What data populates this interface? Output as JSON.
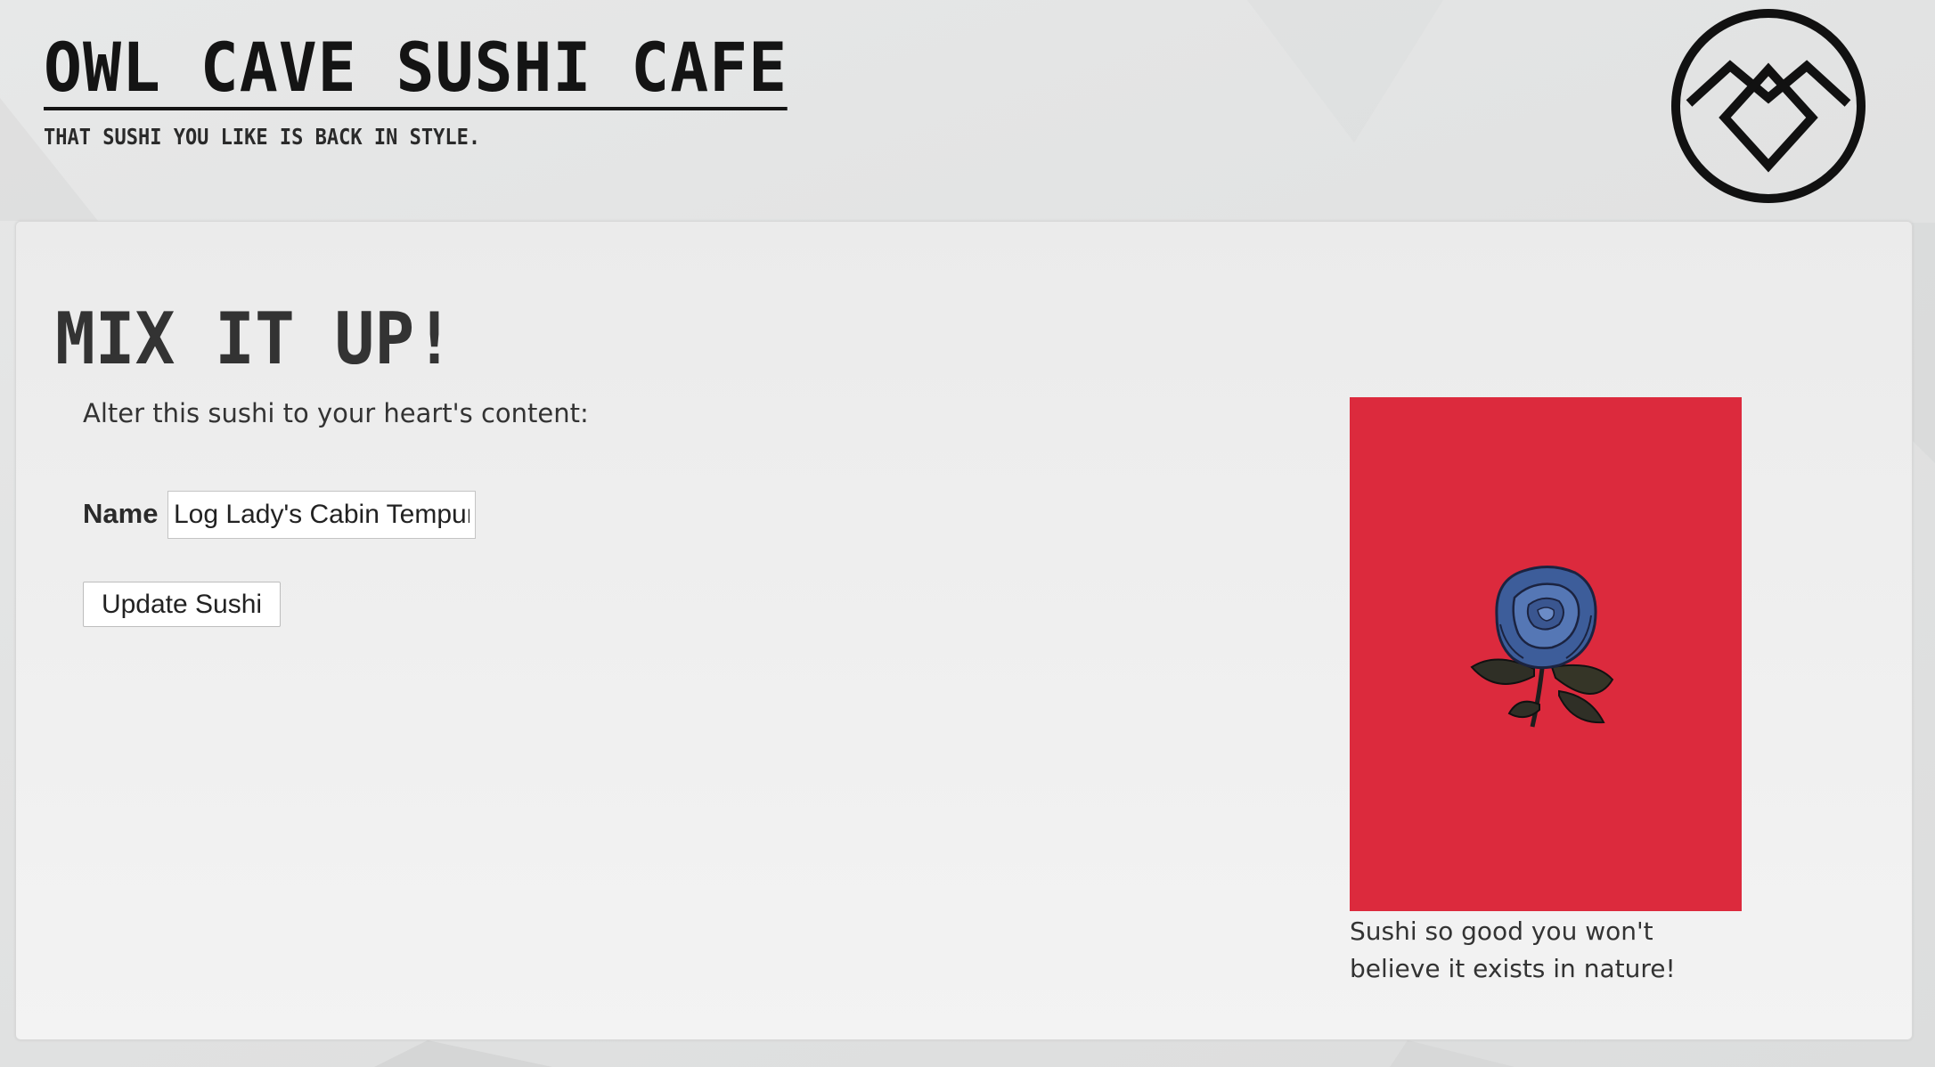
{
  "header": {
    "site_title": "Owl Cave Sushi Cafe",
    "tagline": "That sushi you like is back in style."
  },
  "logo": {
    "icon": "owl-cave-symbol-icon"
  },
  "panel": {
    "heading": "Mix it up!",
    "intro": "Alter this sushi to your heart's content:",
    "form": {
      "name_label": "Name",
      "name_value": "Log Lady's Cabin Tempura",
      "submit_label": "Update Sushi"
    },
    "sushi": {
      "image_icon": "blue-rose-icon",
      "image_background": "#dc2a3d",
      "caption": "Sushi so good you won't believe it exists in nature!"
    }
  }
}
